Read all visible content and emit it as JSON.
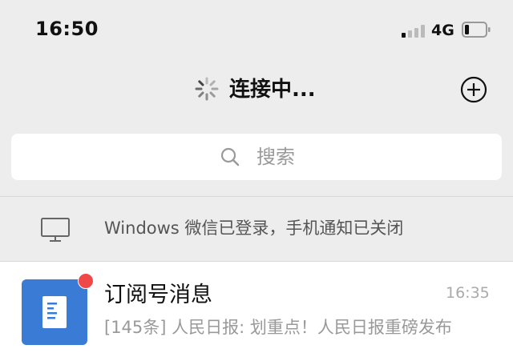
{
  "status_bar": {
    "time": "16:50",
    "network": "4G",
    "signal_bars_active": 1,
    "signal_bars_total": 4,
    "battery_level": 0.15
  },
  "nav": {
    "title": "连接中...",
    "spinner_icon": "loading-spinner-icon",
    "add_icon": "plus-circle-icon"
  },
  "search": {
    "placeholder": "搜索",
    "icon": "search-icon"
  },
  "login_notice": {
    "icon": "monitor-icon",
    "text": "Windows 微信已登录，手机通知已关闭"
  },
  "chats": [
    {
      "name": "订阅号消息",
      "time": "16:35",
      "preview": "[145条] 人民日报: 划重点！人民日报重磅发布",
      "avatar_icon": "document-icon",
      "unread_dot": true
    }
  ],
  "colors": {
    "background": "#ededed",
    "avatar_blue": "#3a7bd5",
    "unread_red": "#f04848",
    "secondary_text": "#999999"
  }
}
